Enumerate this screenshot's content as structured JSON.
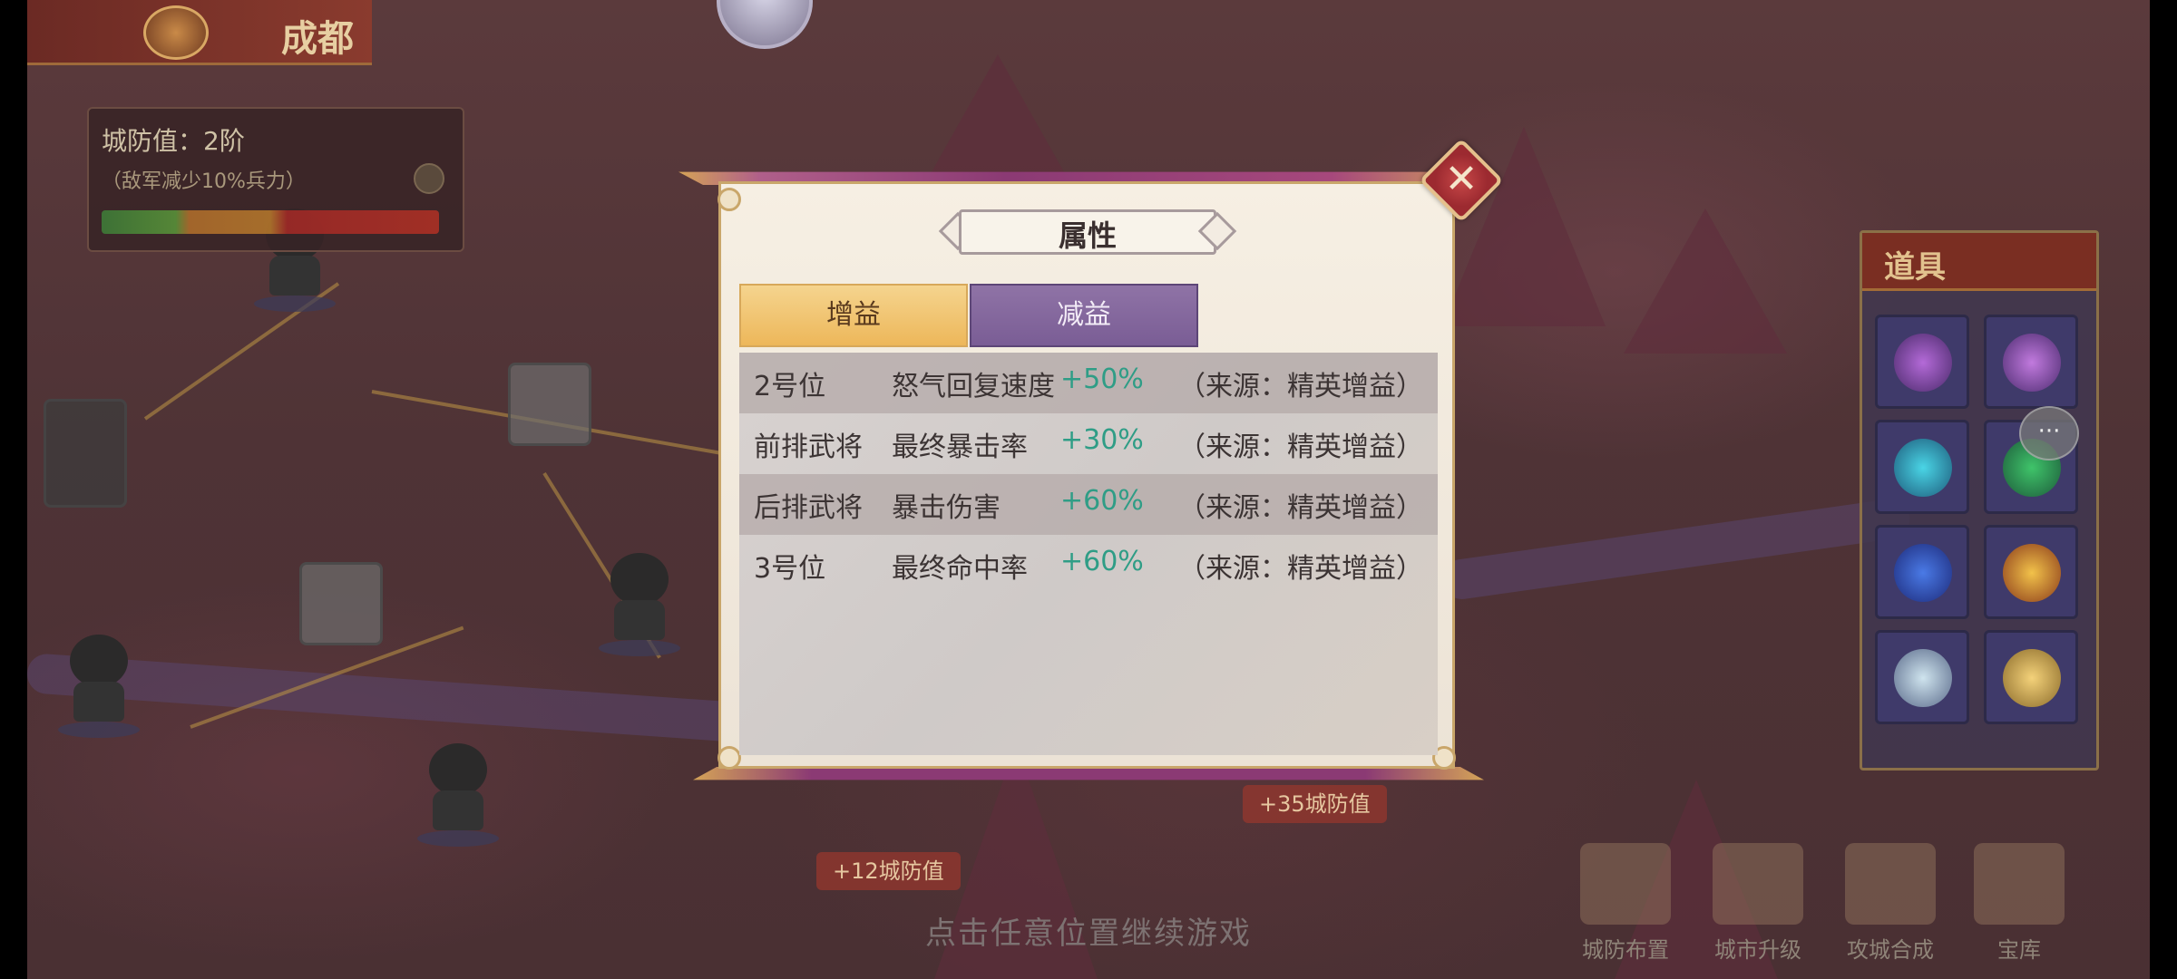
{
  "background": {
    "top_banner_title": "成都",
    "defense": {
      "label": "城防值：2阶",
      "note": "（敌军减少10%兵力）"
    },
    "equip_panel_title": "道具",
    "bottom_buttons": [
      "城防布置",
      "城市升级",
      "攻城合成",
      "宝库"
    ],
    "map_tags": [
      "+35城防值",
      "+12城防值"
    ],
    "chat_icon": "chat-bubble-icon"
  },
  "modal": {
    "title": "属性",
    "tabs": {
      "buff_label": "增益",
      "debuff_label": "减益",
      "active": "buff"
    },
    "rows": [
      {
        "position": "2号位",
        "attribute": "怒气回复速度",
        "value": "+50%",
        "source": "（来源：精英增益）"
      },
      {
        "position": "前排武将",
        "attribute": "最终暴击率",
        "value": "+30%",
        "source": "（来源：精英增益）"
      },
      {
        "position": "后排武将",
        "attribute": "暴击伤害",
        "value": "+60%",
        "source": "（来源：精英增益）"
      },
      {
        "position": "3号位",
        "attribute": "最终命中率",
        "value": "+60%",
        "source": "（来源：精英增益）"
      }
    ],
    "close_icon": "close-x-icon"
  },
  "continue_hint": "点击任意位置继续游戏",
  "colors": {
    "buff_tab": "#edb75a",
    "debuff_tab": "#7a5d95",
    "value_text": "#2f9d86",
    "close_button": "#9c2a30"
  }
}
